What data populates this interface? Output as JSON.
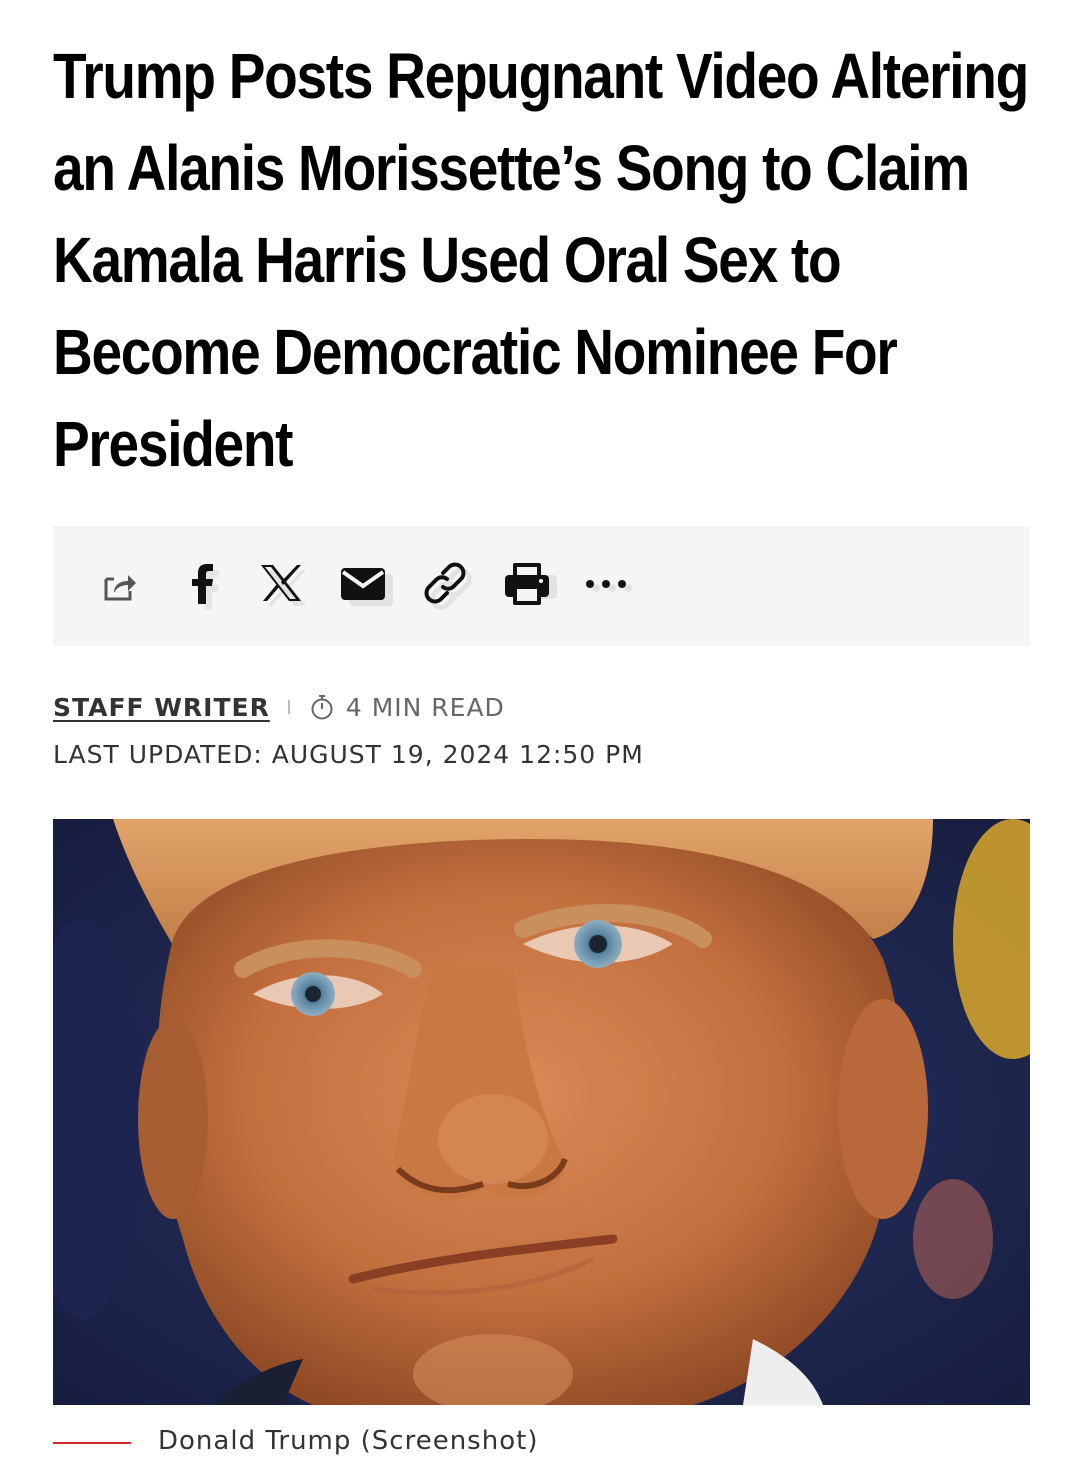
{
  "article": {
    "headline": "Trump Posts Repugnant Video Altering an Alanis Morissette’s Song to Claim Kamala Harris Used Oral Sex to Become Democratic Nominee For President",
    "author": "STAFF WRITER",
    "read_time": "4 MIN READ",
    "last_updated": "LAST UPDATED: AUGUST 19, 2024 12:50 PM",
    "image_caption": "Donald Trump (Screenshot)"
  },
  "share_bar": {
    "icons": [
      "share-icon",
      "facebook-icon",
      "x-icon",
      "email-icon",
      "link-icon",
      "print-icon",
      "more-icon"
    ]
  },
  "colors": {
    "accent_red": "#d6262c",
    "share_bar_bg": "#f5f5f5"
  }
}
